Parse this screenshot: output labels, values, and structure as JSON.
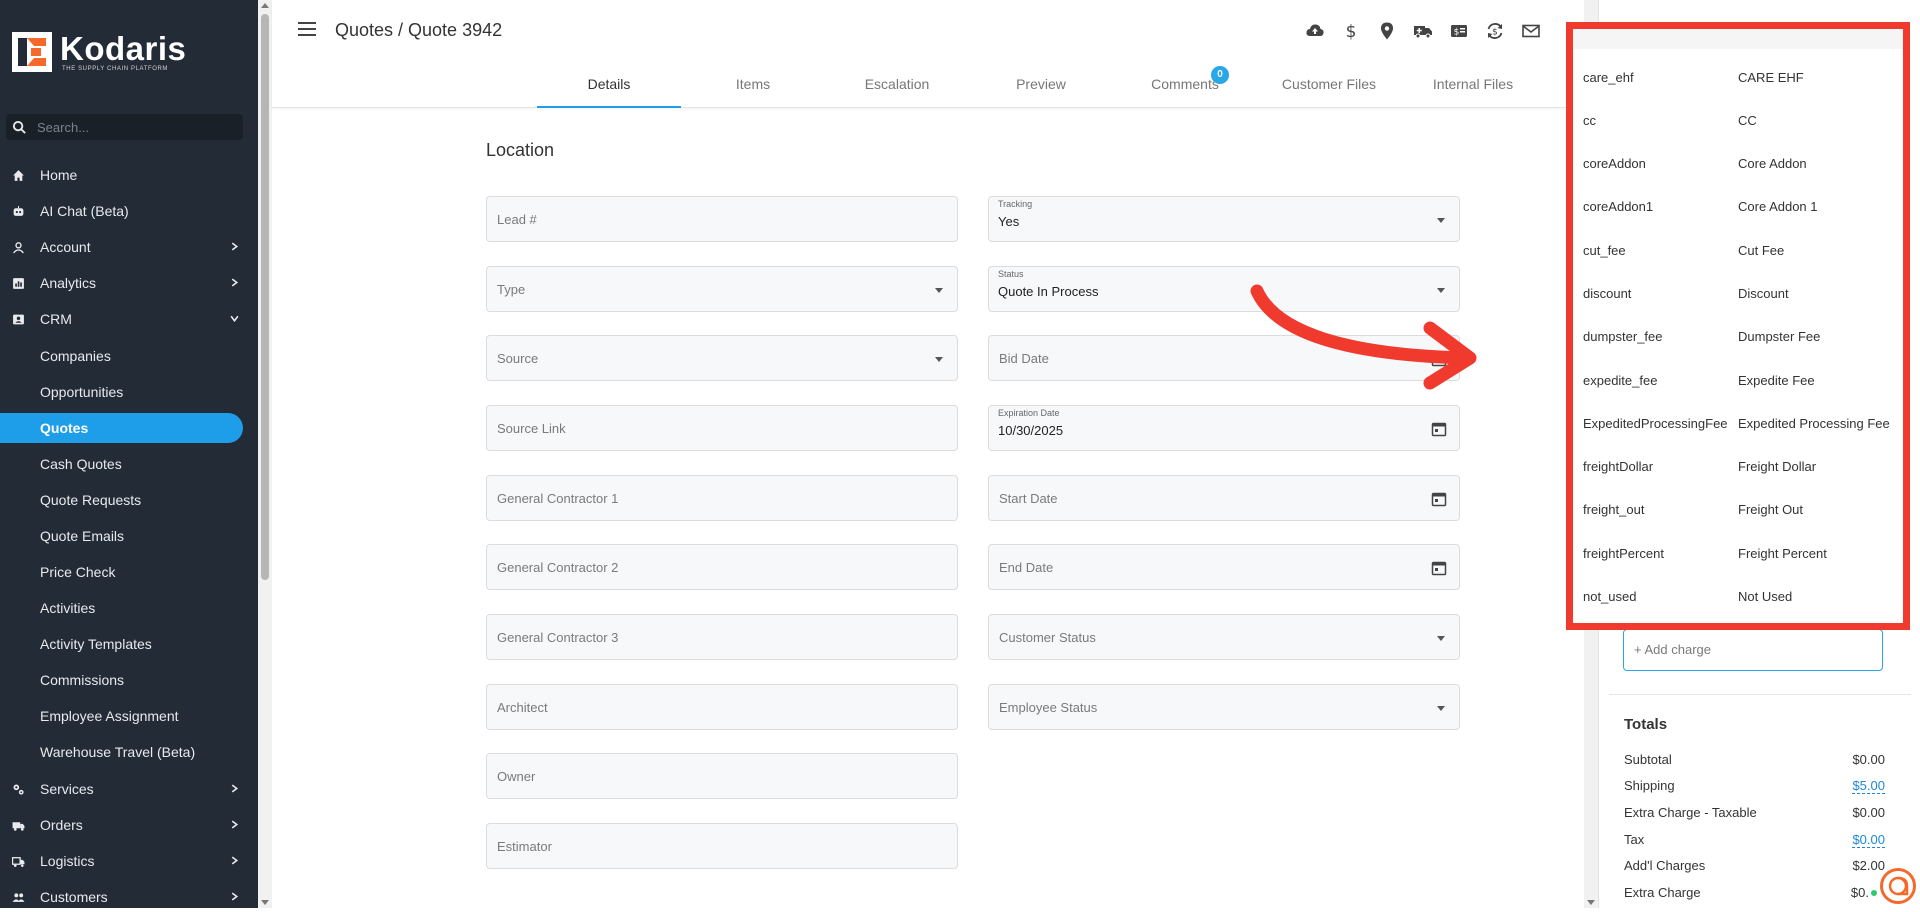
{
  "app": {
    "logo_name": "Kodaris",
    "logo_tagline": "THE SUPPLY CHAIN PLATFORM"
  },
  "sidebar": {
    "search_placeholder": "Search...",
    "items": [
      {
        "label": "Home",
        "icon": "home-icon"
      },
      {
        "label": "AI Chat (Beta)",
        "icon": "robot-icon"
      },
      {
        "label": "Account",
        "icon": "person-icon",
        "chevron": "right"
      },
      {
        "label": "Analytics",
        "icon": "chart-icon",
        "chevron": "right"
      },
      {
        "label": "CRM",
        "icon": "contact-card-icon",
        "chevron": "down"
      }
    ],
    "crm_children": [
      "Companies",
      "Opportunities",
      "Quotes",
      "Cash Quotes",
      "Quote Requests",
      "Quote Emails",
      "Price Check",
      "Activities",
      "Activity Templates",
      "Commissions",
      "Employee Assignment",
      "Warehouse Travel (Beta)"
    ],
    "active_child": "Quotes",
    "bottom_items": [
      {
        "label": "Services",
        "icon": "gears-icon",
        "chevron": "right"
      },
      {
        "label": "Orders",
        "icon": "truck-icon",
        "chevron": "right"
      },
      {
        "label": "Logistics",
        "icon": "delivery-icon",
        "chevron": "right"
      },
      {
        "label": "Customers",
        "icon": "people-icon",
        "chevron": "right"
      }
    ]
  },
  "header": {
    "breadcrumb": "Quotes / Quote 3942",
    "toolbar_icons": [
      "cloud-upload-icon",
      "dollar-icon",
      "location-pin-icon",
      "ambulance-truck-icon",
      "price-tag-icon",
      "currency-exchange-icon",
      "mail-icon"
    ],
    "tabs": [
      {
        "label": "Details",
        "active": true
      },
      {
        "label": "Items"
      },
      {
        "label": "Escalation"
      },
      {
        "label": "Preview"
      },
      {
        "label": "Comments",
        "badge": "0"
      },
      {
        "label": "Customer Files"
      },
      {
        "label": "Internal Files"
      }
    ]
  },
  "form": {
    "section_title": "Location",
    "left_fields": [
      {
        "placeholder": "Lead #",
        "type": "text"
      },
      {
        "placeholder": "Type",
        "type": "select"
      },
      {
        "placeholder": "Source",
        "type": "select"
      },
      {
        "placeholder": "Source Link",
        "type": "text"
      },
      {
        "placeholder": "General Contractor 1",
        "type": "text"
      },
      {
        "placeholder": "General Contractor 2",
        "type": "text"
      },
      {
        "placeholder": "General Contractor 3",
        "type": "text"
      },
      {
        "placeholder": "Architect",
        "type": "text"
      },
      {
        "placeholder": "Owner",
        "type": "text"
      },
      {
        "placeholder": "Estimator",
        "type": "text"
      }
    ],
    "right_fields": [
      {
        "label": "Tracking",
        "value": "Yes",
        "type": "select"
      },
      {
        "label": "Status",
        "value": "Quote In Process",
        "type": "select"
      },
      {
        "placeholder": "Bid Date",
        "type": "date"
      },
      {
        "label": "Expiration Date",
        "value": "10/30/2025",
        "type": "date"
      },
      {
        "placeholder": "Start Date",
        "type": "date"
      },
      {
        "placeholder": "End Date",
        "type": "date"
      },
      {
        "placeholder": "Customer Status",
        "type": "select"
      },
      {
        "placeholder": "Employee Status",
        "type": "select"
      }
    ]
  },
  "charge_dropdown": {
    "options": [
      {
        "key": "care_ehf",
        "label": "CARE EHF"
      },
      {
        "key": "cc",
        "label": "CC"
      },
      {
        "key": "coreAddon",
        "label": "Core Addon"
      },
      {
        "key": "coreAddon1",
        "label": "Core Addon 1"
      },
      {
        "key": "cut_fee",
        "label": "Cut Fee"
      },
      {
        "key": "discount",
        "label": "Discount"
      },
      {
        "key": "dumpster_fee",
        "label": "Dumpster Fee"
      },
      {
        "key": "expedite_fee",
        "label": "Expedite Fee"
      },
      {
        "key": "ExpeditedProcessingFee",
        "label": "Expedited Processing Fee"
      },
      {
        "key": "freightDollar",
        "label": "Freight Dollar"
      },
      {
        "key": "freight_out",
        "label": "Freight Out"
      },
      {
        "key": "freightPercent",
        "label": "Freight Percent"
      },
      {
        "key": "not_used",
        "label": "Not Used"
      }
    ],
    "highlight_color": "#f03a2e"
  },
  "right_panel": {
    "add_charge_placeholder": "+ Add charge",
    "totals_title": "Totals",
    "totals": [
      {
        "label": "Subtotal",
        "value": "$0.00",
        "link": false
      },
      {
        "label": "Shipping",
        "value": "$5.00",
        "link": true
      },
      {
        "label": "Extra Charge - Taxable",
        "value": "$0.00",
        "link": false
      },
      {
        "label": "Tax",
        "value": "$0.00",
        "link": true
      },
      {
        "label": "Add'l Charges",
        "value": "$2.00",
        "link": false
      },
      {
        "label": "Extra Charge",
        "value": "$0.",
        "link": false
      }
    ]
  },
  "colors": {
    "sidebar_bg": "#222b36",
    "accent": "#1e9de8",
    "annotation_red": "#f03a2e"
  }
}
